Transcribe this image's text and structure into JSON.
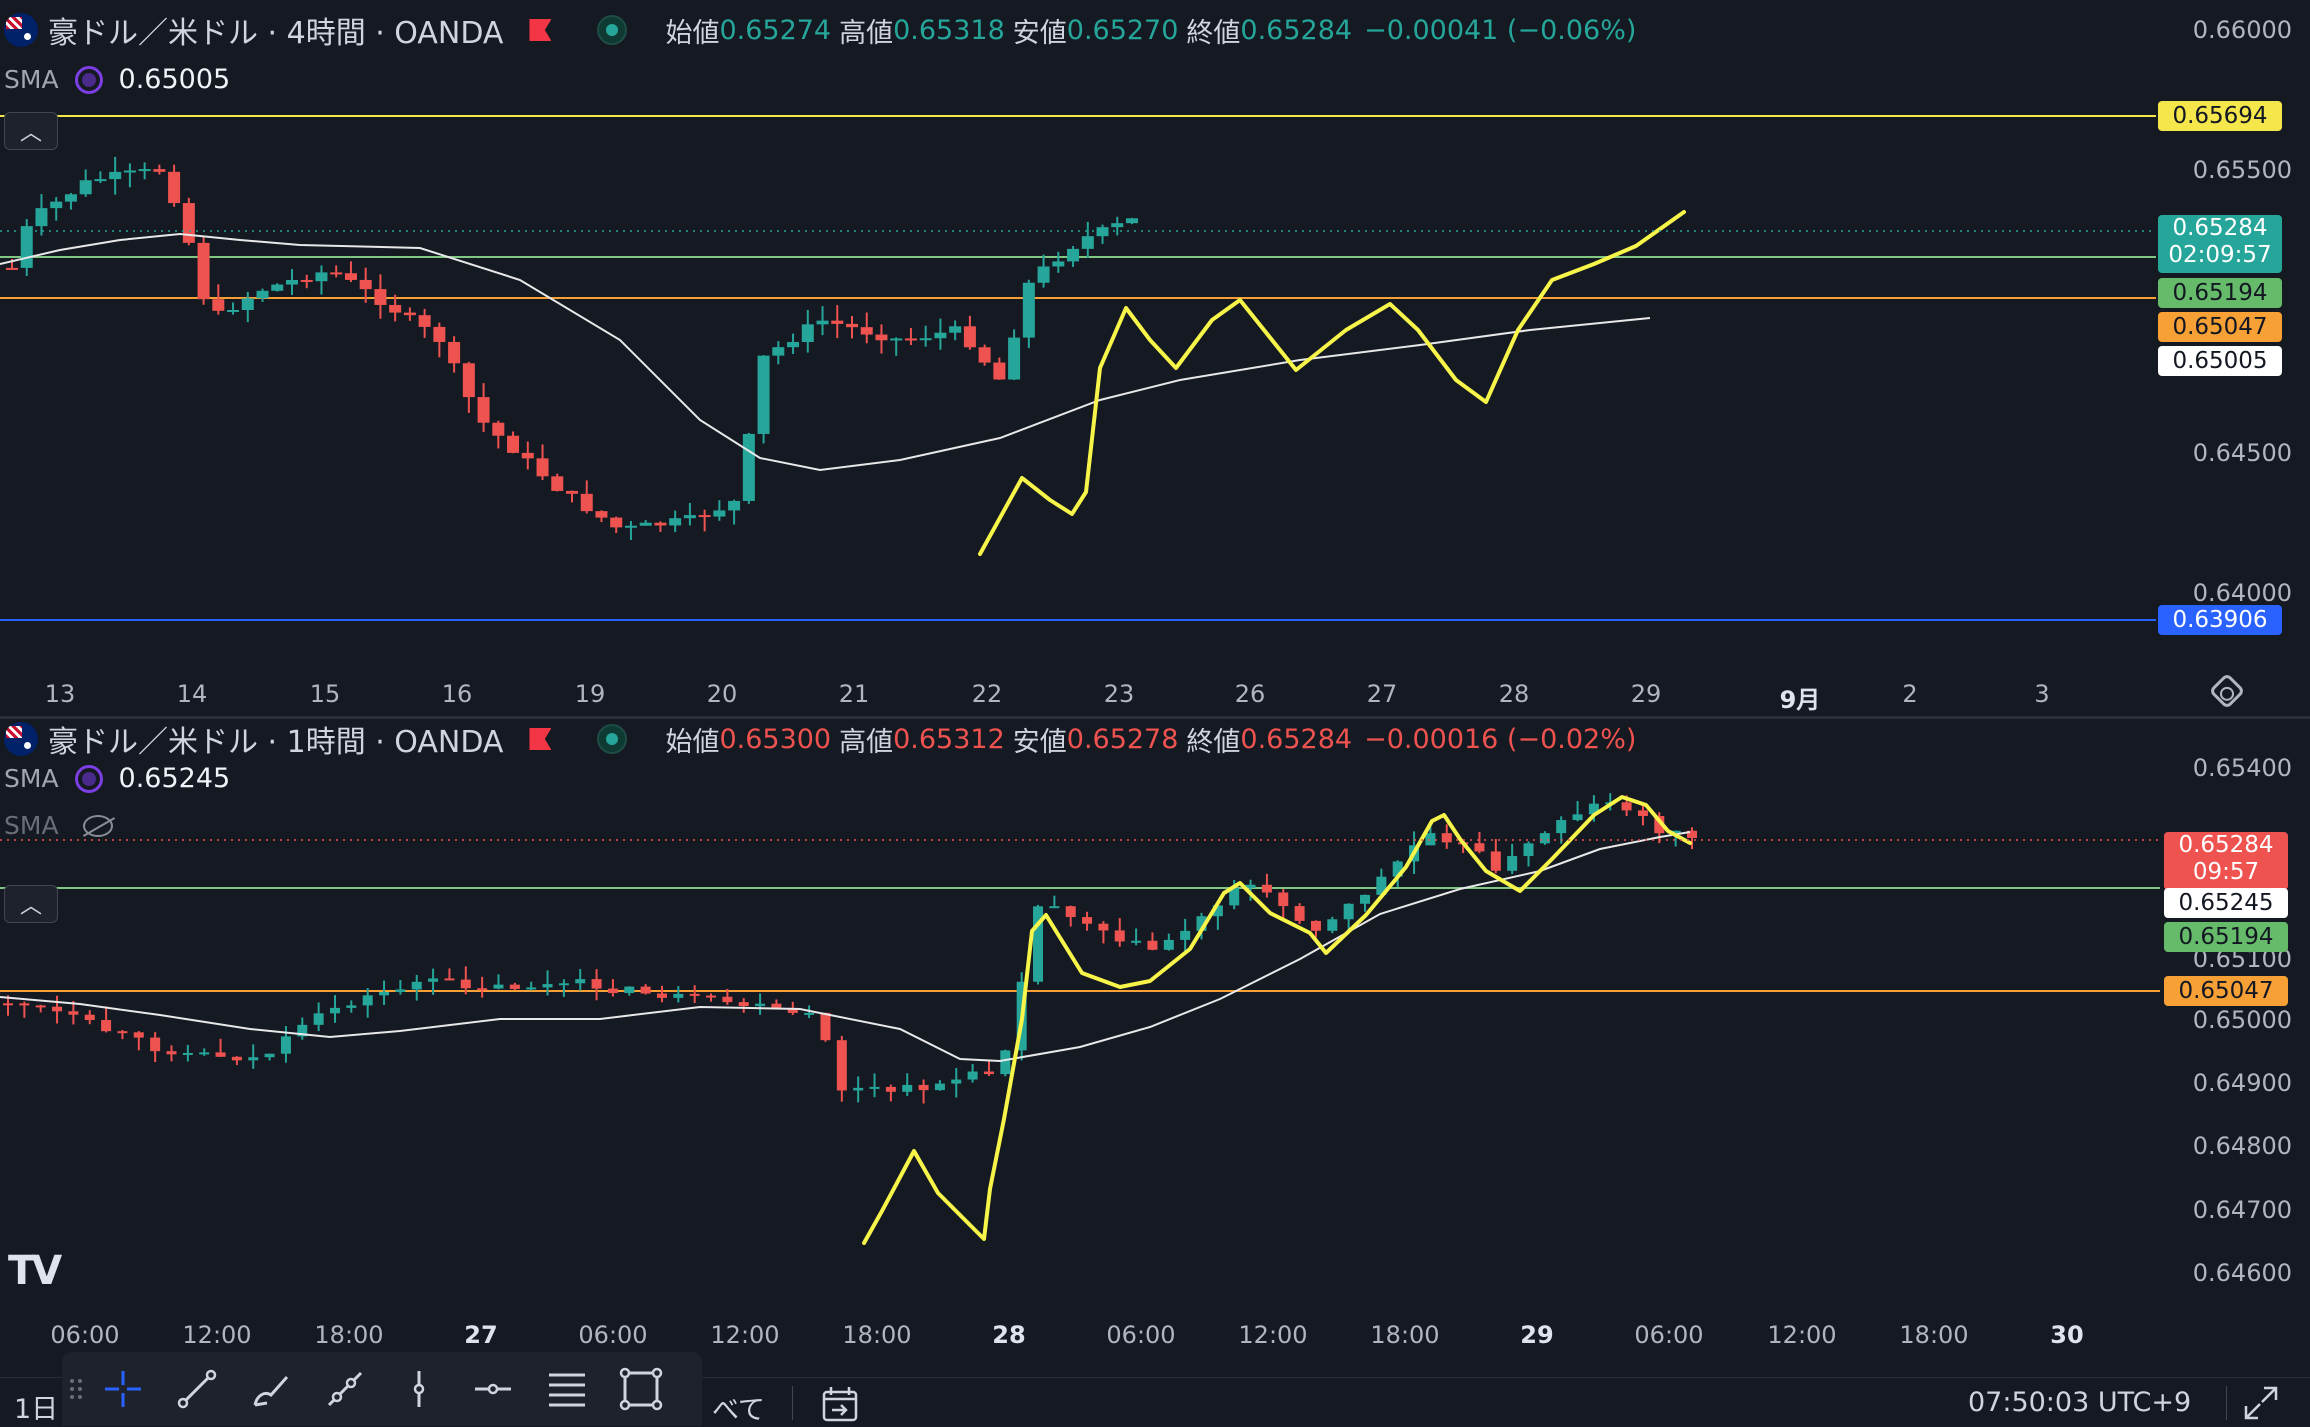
{
  "chart1": {
    "title": "豪ドル／米ドル · 4時間 · OANDA",
    "ohlc": {
      "o_label": "始値",
      "o": "0.65274",
      "h_label": "高値",
      "h": "0.65318",
      "l_label": "安値",
      "l": "0.65270",
      "c_label": "終値",
      "c": "0.65284",
      "chg": "−0.00041 (−0.06%)"
    },
    "sma_label": "SMA",
    "sma_value": "0.65005",
    "collapse_icon": "chevron-up-icon",
    "price_axis": [
      "0.66000",
      "0.65500",
      "0.64500",
      "0.64000"
    ],
    "tags": {
      "yellow": "0.65694",
      "last_price": "0.65284",
      "countdown": "02:09:57",
      "green": "0.65194",
      "orange": "0.65047",
      "sma": "0.65005",
      "blue": "0.63906"
    },
    "time_axis": [
      {
        "t": "13",
        "bold": false
      },
      {
        "t": "14",
        "bold": false
      },
      {
        "t": "15",
        "bold": false
      },
      {
        "t": "16",
        "bold": false
      },
      {
        "t": "19",
        "bold": false
      },
      {
        "t": "20",
        "bold": false
      },
      {
        "t": "21",
        "bold": false
      },
      {
        "t": "22",
        "bold": false
      },
      {
        "t": "23",
        "bold": false
      },
      {
        "t": "26",
        "bold": false
      },
      {
        "t": "27",
        "bold": false
      },
      {
        "t": "28",
        "bold": false
      },
      {
        "t": "29",
        "bold": false
      },
      {
        "t": "9月",
        "bold": true
      },
      {
        "t": "2",
        "bold": false
      },
      {
        "t": "3",
        "bold": false
      }
    ],
    "settings_icon": "settings-icon"
  },
  "chart2": {
    "title": "豪ドル／米ドル · 1時間 · OANDA",
    "ohlc": {
      "o_label": "始値",
      "o": "0.65300",
      "h_label": "高値",
      "h": "0.65312",
      "l_label": "安値",
      "l": "0.65278",
      "c_label": "終値",
      "c": "0.65284",
      "chg": "−0.00016 (−0.02%)"
    },
    "sma_label": "SMA",
    "sma_value": "0.65245",
    "sma2_label": "SMA",
    "sma2_icon": "eye-hidden-icon",
    "collapse_icon": "chevron-up-icon",
    "price_axis": [
      "0.65400",
      "0.65100",
      "0.65000",
      "0.64900",
      "0.64800",
      "0.64700",
      "0.64600"
    ],
    "tags": {
      "last_price": "0.65284",
      "countdown": "09:57",
      "sma": "0.65245",
      "green": "0.65194",
      "orange": "0.65047"
    },
    "time_axis": [
      {
        "t": "06:00",
        "bold": false
      },
      {
        "t": "12:00",
        "bold": false
      },
      {
        "t": "18:00",
        "bold": false
      },
      {
        "t": "27",
        "bold": true
      },
      {
        "t": "06:00",
        "bold": false
      },
      {
        "t": "12:00",
        "bold": false
      },
      {
        "t": "18:00",
        "bold": false
      },
      {
        "t": "28",
        "bold": true
      },
      {
        "t": "06:00",
        "bold": false
      },
      {
        "t": "12:00",
        "bold": false
      },
      {
        "t": "18:00",
        "bold": false
      },
      {
        "t": "29",
        "bold": true
      },
      {
        "t": "06:00",
        "bold": false
      },
      {
        "t": "12:00",
        "bold": false
      },
      {
        "t": "18:00",
        "bold": false
      },
      {
        "t": "30",
        "bold": true
      }
    ]
  },
  "colors": {
    "up": "#26a69a",
    "down": "#ef5350",
    "sma": "#e8e8e8",
    "yellow_line": "#f5e64b",
    "green_line": "#81c784",
    "orange_line": "#f7a035",
    "blue_line": "#2962ff",
    "drawing": "#f7f44a"
  },
  "logo": "TV",
  "bottom": {
    "interval": "1日",
    "all_suffix": "べて",
    "clock": "07:50:03 UTC+9",
    "tools": [
      "crosshair-icon",
      "trend-line-icon",
      "brush-icon",
      "ray-icon",
      "vertical-line-icon",
      "horizontal-line-icon",
      "fib-icon",
      "rectangle-icon"
    ],
    "date_range_icon": "date-range-icon",
    "fullscreen_icon": "fullscreen-icon"
  }
}
